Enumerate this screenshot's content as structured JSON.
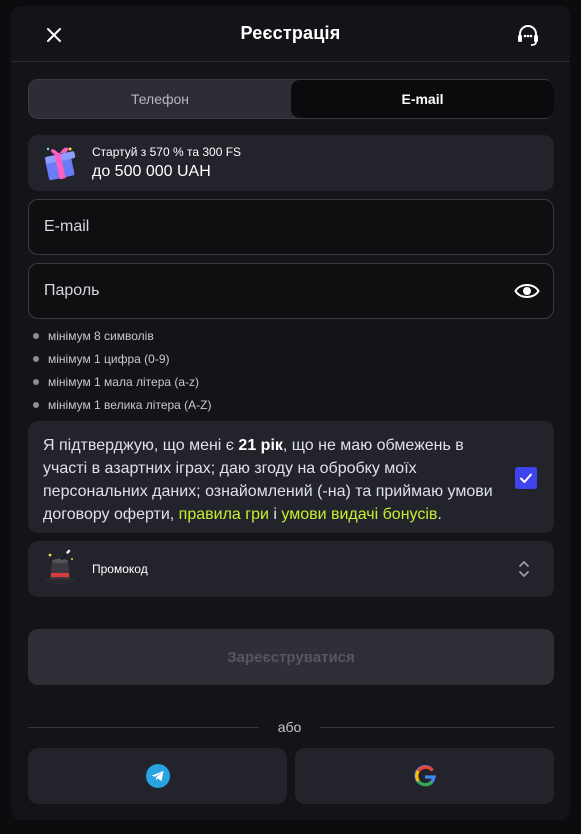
{
  "header": {
    "title": "Реєстрація",
    "close_icon": "close-icon",
    "support_icon": "headset-icon"
  },
  "tabs": [
    {
      "label": "Телефон",
      "active": false
    },
    {
      "label": "E-mail",
      "active": true
    }
  ],
  "bonus": {
    "icon": "gift-icon",
    "line1": "Стартуй з 570 % та 300 FS",
    "line2": "до 500 000 UAH"
  },
  "form": {
    "email_placeholder": "E-mail",
    "email_value": "",
    "password_placeholder": "Пароль",
    "password_value": "",
    "password_toggle_icon": "eye-icon"
  },
  "password_rules": [
    "мінімум 8 символів",
    "мінімум 1 цифра (0-9)",
    "мінімум 1 мала літера (a-z)",
    "мінімум 1 велика літера (A-Z)"
  ],
  "consent": {
    "part1": "Я підтверджую, що мені є ",
    "age": "21 рік",
    "part2": ", що не маю обмежень в участі в азартних іграх; даю згоду на обробку моїх персональних даних; ознайомлений (-на) та приймаю умови договору оферти, ",
    "link1": "правила гри",
    "part3": " і ",
    "link2": "умови видачі бонусів",
    "part4": ".",
    "checked": true
  },
  "promo": {
    "icon": "magic-hat-icon",
    "label": "Промокод",
    "chevron_icon": "chevron-updown-icon"
  },
  "submit_label": "Зареєструватися",
  "divider_label": "або",
  "social": [
    {
      "name": "telegram",
      "icon": "telegram-icon"
    },
    {
      "name": "google",
      "icon": "google-icon"
    }
  ],
  "colors": {
    "background": "#141418",
    "card": "#22232b",
    "accent_link": "#c8f02d",
    "checkbox": "#3f44f0",
    "telegram": "#2aa3e3"
  }
}
